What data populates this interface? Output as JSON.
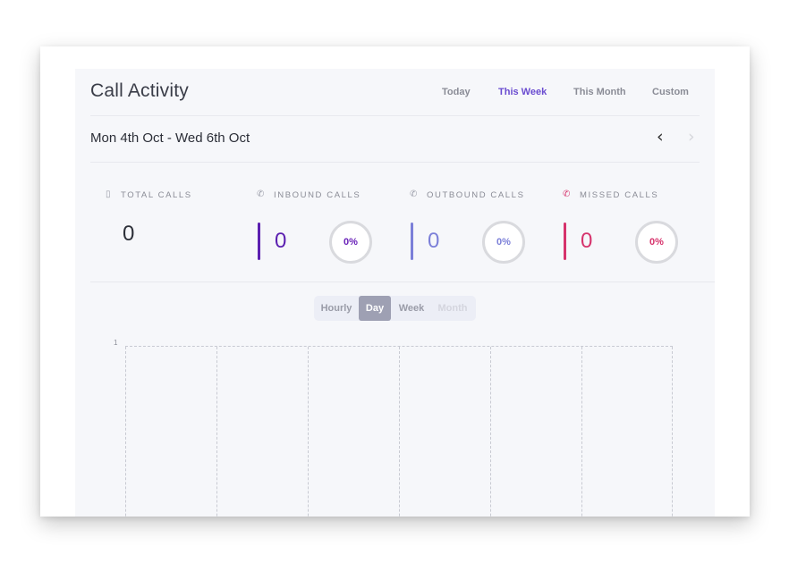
{
  "header": {
    "title": "Call Activity",
    "tabs": [
      {
        "label": "Today",
        "active": false
      },
      {
        "label": "This Week",
        "active": true
      },
      {
        "label": "This Month",
        "active": false
      },
      {
        "label": "Custom",
        "active": false
      }
    ]
  },
  "range": {
    "label": "Mon 4th Oct - Wed 6th Oct",
    "prev_icon": "chevron-left-icon",
    "next_icon": "chevron-right-icon"
  },
  "stats": {
    "total": {
      "label": "TOTAL CALLS",
      "value": "0",
      "icon": "phone-device-icon"
    },
    "inbound": {
      "label": "INBOUND CALLS",
      "value": "0",
      "percent": "0%",
      "color": "#5b1fb0",
      "icon": "phone-icon"
    },
    "outbound": {
      "label": "OUTBOUND CALLS",
      "value": "0",
      "percent": "0%",
      "color": "#7b7fd8",
      "icon": "phone-icon"
    },
    "missed": {
      "label": "MISSED CALLS",
      "value": "0",
      "percent": "0%",
      "color": "#d6336c",
      "icon": "phone-missed-icon"
    }
  },
  "granularity": {
    "options": [
      {
        "label": "Hourly",
        "state": "normal"
      },
      {
        "label": "Day",
        "state": "active"
      },
      {
        "label": "Week",
        "state": "normal"
      },
      {
        "label": "Month",
        "state": "disabled"
      }
    ]
  },
  "chart": {
    "y_top_tick": "1"
  }
}
